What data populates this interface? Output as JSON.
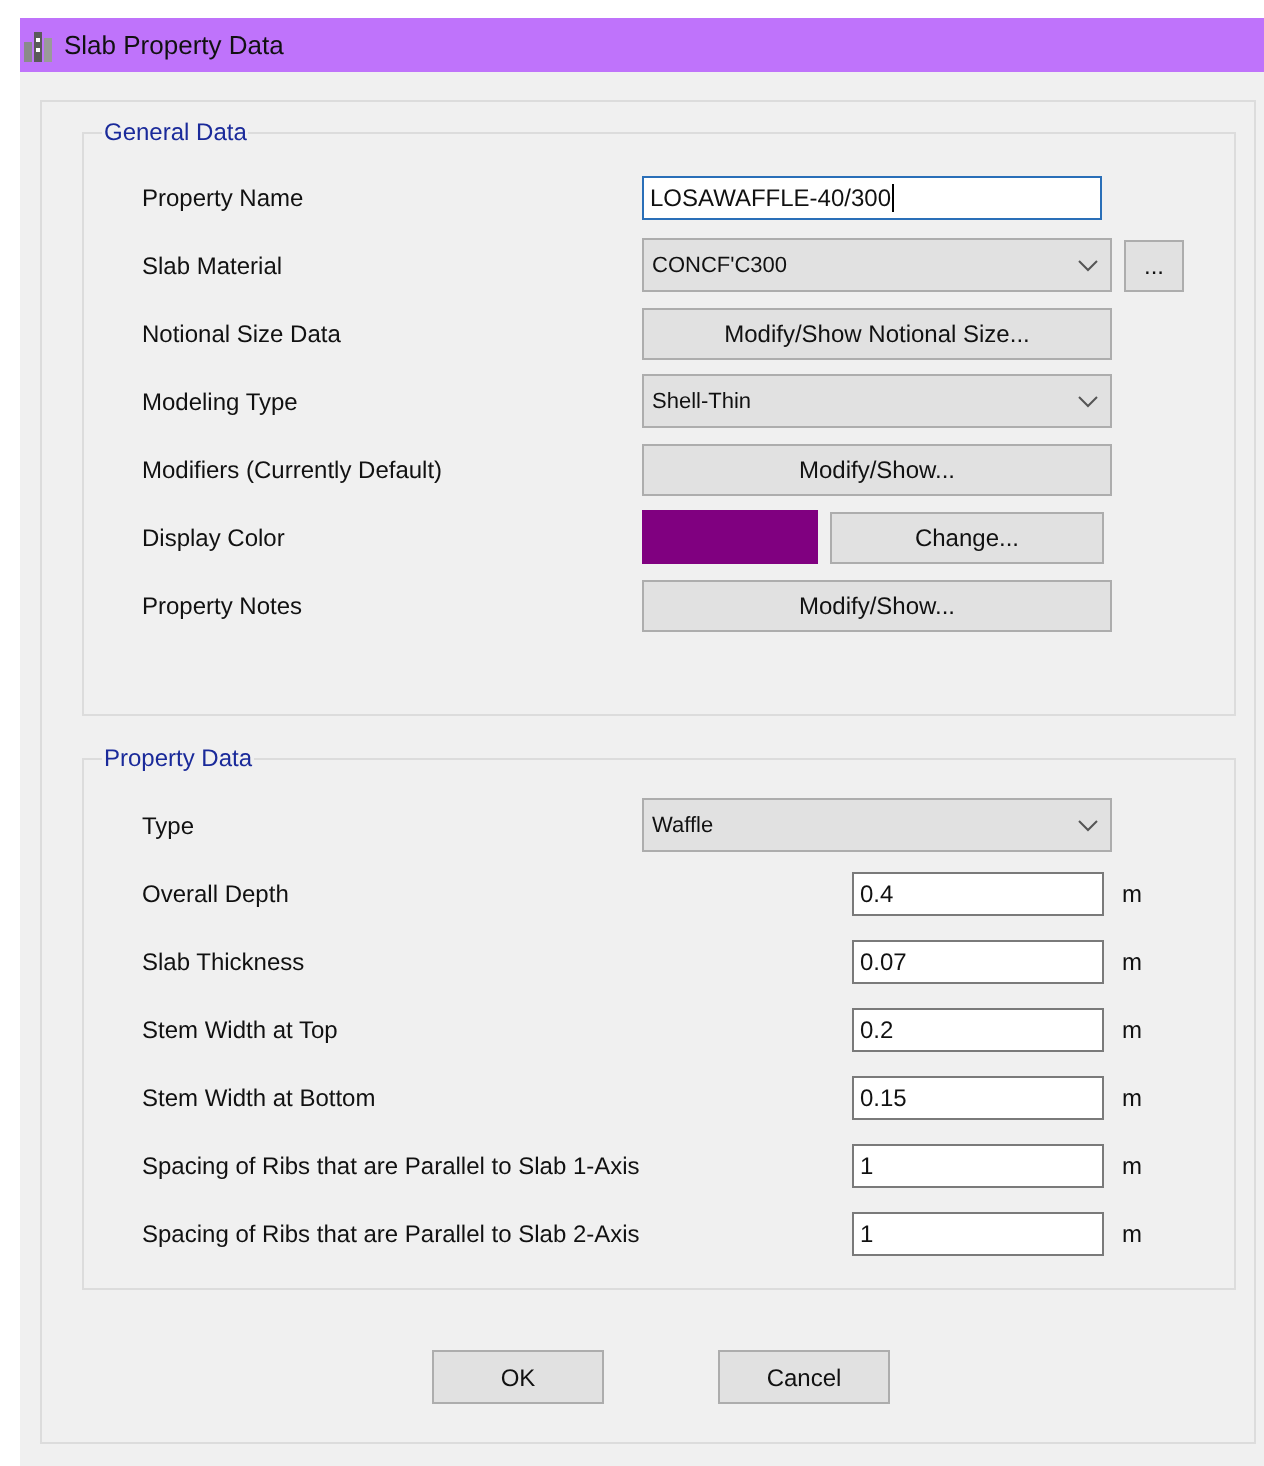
{
  "window": {
    "title": "Slab Property Data"
  },
  "general_data": {
    "title": "General Data",
    "rows": [
      {
        "label": "Property Name",
        "kind": "text",
        "value": "LOSAWAFFLE-40/300",
        "focused": true
      },
      {
        "label": "Slab Material",
        "kind": "combo",
        "value": "CONCF'C300",
        "extra_button": "..."
      },
      {
        "label": "Notional Size Data",
        "kind": "button",
        "button": "Modify/Show Notional Size..."
      },
      {
        "label": "Modeling Type",
        "kind": "combo",
        "value": "Shell-Thin"
      },
      {
        "label": "Modifiers (Currently Default)",
        "kind": "button",
        "button": "Modify/Show..."
      },
      {
        "label": "Display Color",
        "kind": "color",
        "color": "#800080",
        "button": "Change..."
      },
      {
        "label": "Property Notes",
        "kind": "button",
        "button": "Modify/Show..."
      }
    ]
  },
  "property_data": {
    "title": "Property Data",
    "rows": [
      {
        "label": "Type",
        "kind": "combo",
        "value": "Waffle"
      },
      {
        "label": "Overall Depth",
        "kind": "number",
        "value": "0.4",
        "unit": "m"
      },
      {
        "label": "Slab Thickness",
        "kind": "number",
        "value": "0.07",
        "unit": "m"
      },
      {
        "label": "Stem Width at Top",
        "kind": "number",
        "value": "0.2",
        "unit": "m"
      },
      {
        "label": "Stem Width at Bottom",
        "kind": "number",
        "value": "0.15",
        "unit": "m"
      },
      {
        "label": "Spacing of Ribs that are Parallel to Slab 1-Axis",
        "kind": "number",
        "value": "1",
        "unit": "m"
      },
      {
        "label": "Spacing of Ribs that are Parallel to Slab 2-Axis",
        "kind": "number",
        "value": "1",
        "unit": "m"
      }
    ]
  },
  "buttons": [
    "OK",
    "Cancel"
  ]
}
